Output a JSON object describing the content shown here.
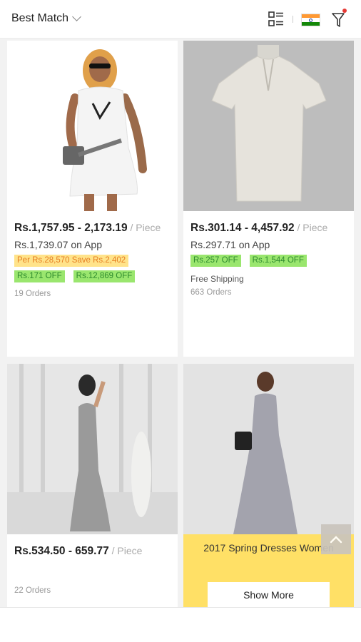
{
  "header": {
    "sort_label": "Best Match",
    "icons": [
      "list-view-icon",
      "india-flag-icon",
      "filter-icon"
    ],
    "flag_colors": [
      "#ff9933",
      "#ffffff",
      "#138808"
    ]
  },
  "products": [
    {
      "price": "Rs.1,757.95 - 2,173.19",
      "unit": " / Piece",
      "app_price": "Rs.1,739.07 on App",
      "tags": [
        {
          "text": "Per Rs.28,570 Save Rs.2,402",
          "color": "yellow"
        },
        {
          "text": "Rs.171 OFF",
          "color": "green"
        },
        {
          "text": "Rs.12,869 OFF",
          "color": "green"
        }
      ],
      "orders": "19 Orders"
    },
    {
      "price": "Rs.301.14 - 4,457.92",
      "unit": " / Piece",
      "app_price": "Rs.297.71 on App",
      "tags": [
        {
          "text": "Rs.257 OFF",
          "color": "green"
        },
        {
          "text": "Rs.1,544 OFF",
          "color": "green"
        }
      ],
      "shipping": "Free Shipping",
      "orders": "663 Orders"
    },
    {
      "price": "Rs.534.50 - 659.77",
      "unit": " / Piece",
      "orders": "22 Orders"
    }
  ],
  "promo": {
    "title": "2017 Spring Dresses Women",
    "button": "Show More"
  },
  "colors": {
    "tag_yellow_bg": "#ffe38a",
    "tag_green_bg": "#9ae66e",
    "promo_bg": "#ffe066"
  }
}
